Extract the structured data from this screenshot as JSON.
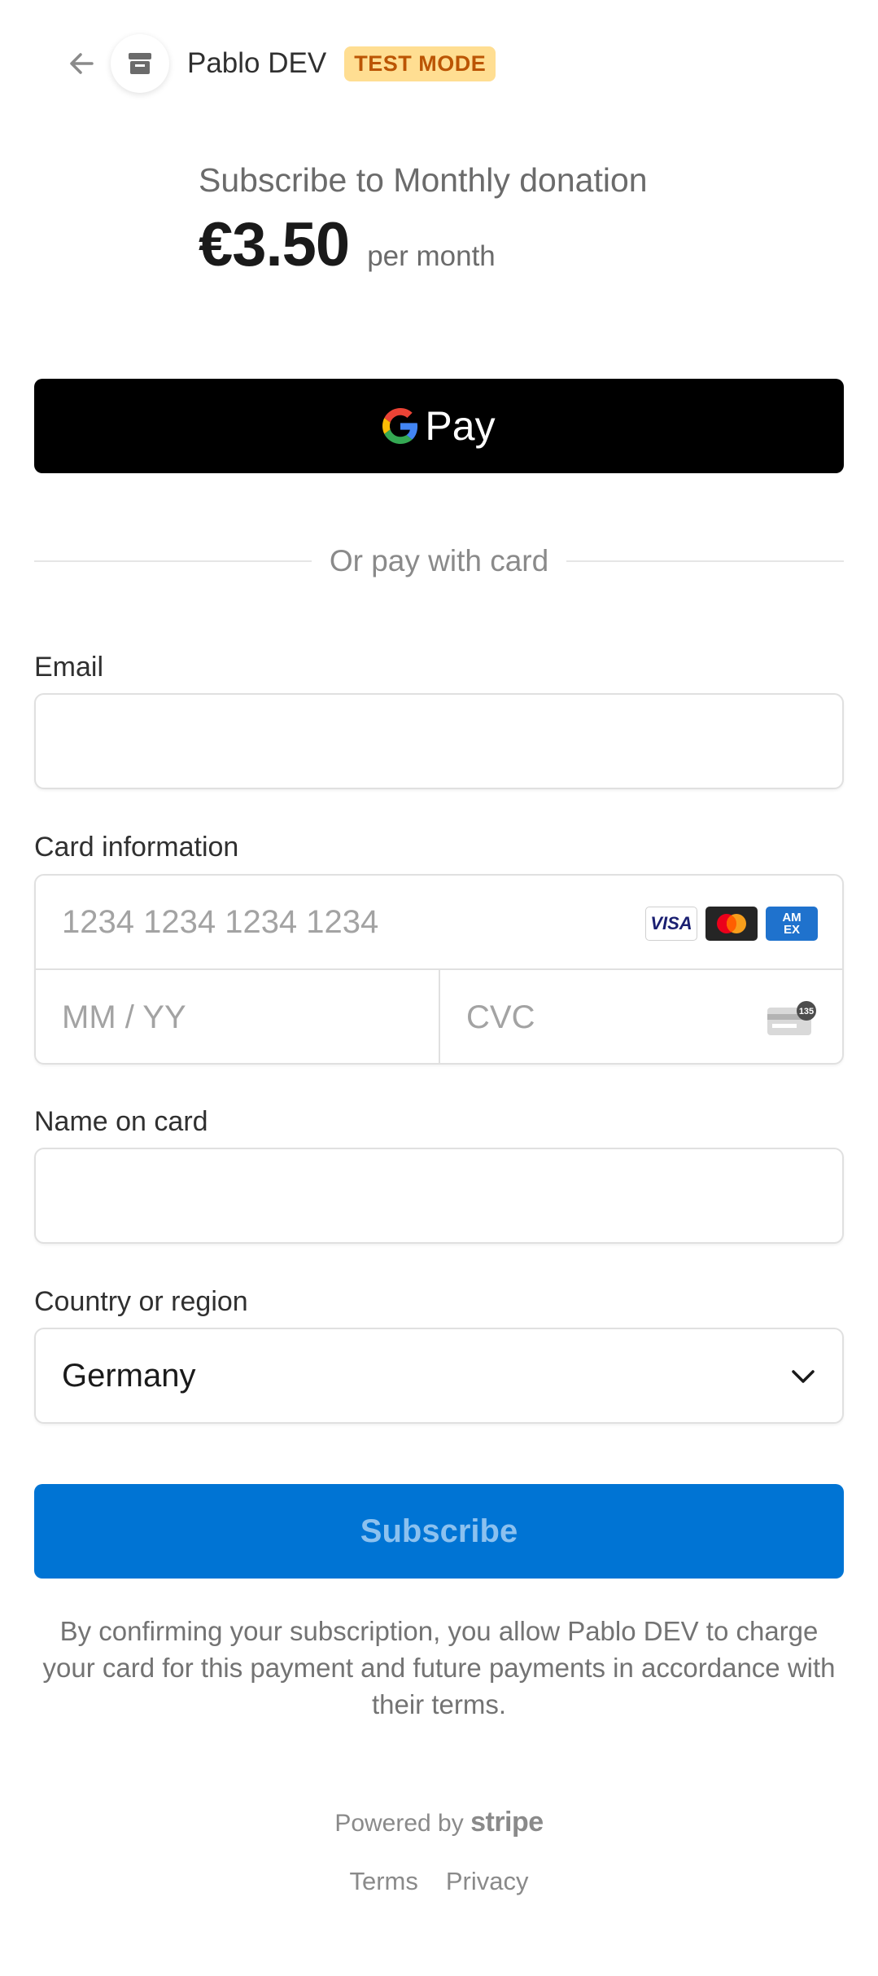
{
  "header": {
    "merchant_name": "Pablo DEV",
    "badge": "TEST MODE"
  },
  "summary": {
    "title": "Subscribe to Monthly donation",
    "price": "€3.50",
    "period": "per month"
  },
  "gpay": {
    "label": "Pay"
  },
  "divider": {
    "text": "Or pay with card"
  },
  "form": {
    "email": {
      "label": "Email",
      "value": "",
      "placeholder": ""
    },
    "card": {
      "label": "Card information",
      "number_placeholder": "1234 1234 1234 1234",
      "expiry_placeholder": "MM / YY",
      "cvc_placeholder": "CVC",
      "brands": [
        "VISA",
        "Mastercard",
        "AMEX"
      ],
      "cvc_icon_text": "135"
    },
    "name": {
      "label": "Name on card",
      "value": "",
      "placeholder": ""
    },
    "country": {
      "label": "Country or region",
      "selected": "Germany"
    }
  },
  "subscribe_button": {
    "label": "Subscribe"
  },
  "legal": "By confirming your subscription, you allow Pablo DEV to charge your card for this payment and future payments in accordance with their terms.",
  "footer": {
    "powered_by": "Powered by",
    "brand": "stripe",
    "links": [
      "Terms",
      "Privacy"
    ]
  },
  "colors": {
    "primary": "#0074d4",
    "badge_bg": "#ffde92",
    "badge_text": "#bb5504"
  }
}
